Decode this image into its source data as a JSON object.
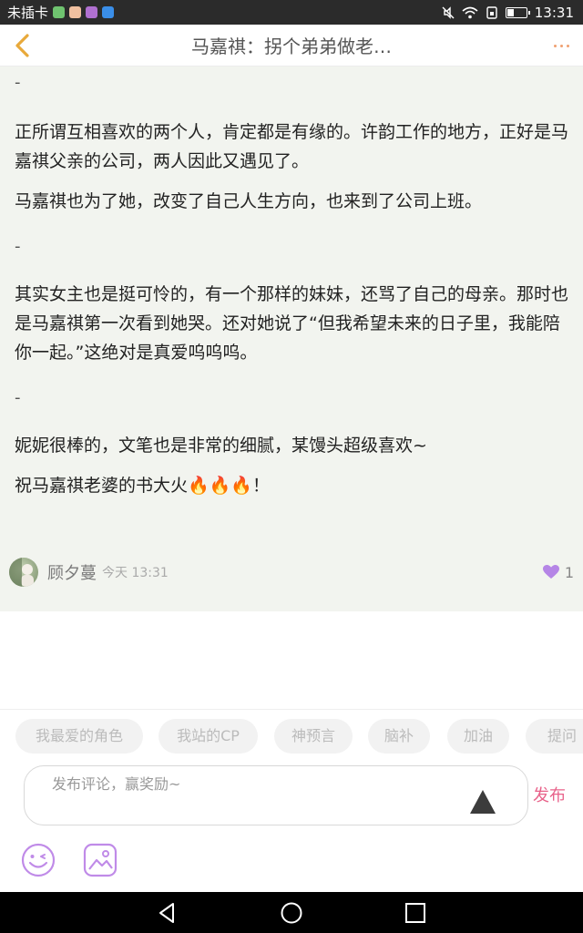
{
  "status_bar": {
    "carrier": "未插卡",
    "time": "13:31",
    "battery_level": 0.35
  },
  "header": {
    "title": "马嘉祺：拐个弟弟做老…",
    "back_icon": "chevron-left-icon",
    "more_icon": "more-dots-icon",
    "accent_color": "#f0a070"
  },
  "content": {
    "paragraphs": [
      "-",
      "正所谓互相喜欢的两个人，肯定都是有缘的。许韵工作的地方，正好是马嘉祺父亲的公司，两人因此又遇见了。",
      "马嘉祺也为了她，改变了自己人生方向，也来到了公司上班。",
      "-",
      "其实女主也是挺可怜的，有一个那样的妹妹，还骂了自己的母亲。那时也是马嘉祺第一次看到她哭。还对她说了“但我希望未来的日子里，我能陪你一起。”这绝对是真爱呜呜呜。",
      "-",
      "妮妮很棒的，文笔也是非常的细腻，某馒头超级喜欢~",
      "祝马嘉祺老婆的书大火🔥🔥🔥！"
    ]
  },
  "author": {
    "name": "顾夕蔓",
    "time": "今天 13:31",
    "like_count": "1",
    "like_color": "#b585e6"
  },
  "tags": [
    "我最爱的角色",
    "我站的CP",
    "神预言",
    "脑补",
    "加油",
    "提问"
  ],
  "comment": {
    "placeholder": "发布评论，赢奖励~",
    "publish_label": "发布",
    "publish_color": "#e8628a"
  },
  "toolbar": {
    "emoji_icon": "emoji-icon",
    "image_icon": "image-icon",
    "icon_color": "#c08be8"
  }
}
